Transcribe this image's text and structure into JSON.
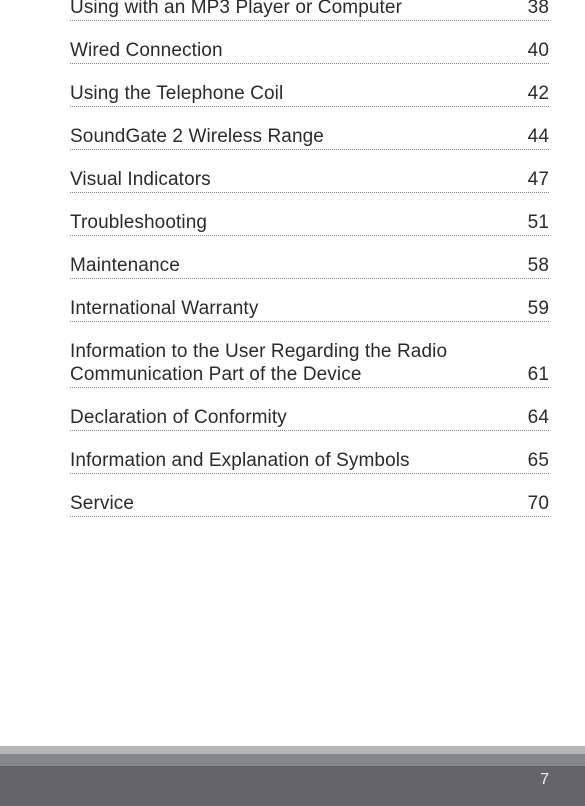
{
  "toc": {
    "entries": [
      {
        "title": "Using with an MP3 Player or Computer",
        "page": "38"
      },
      {
        "title": "Wired Connection",
        "page": "40"
      },
      {
        "title": "Using the Telephone Coil",
        "page": "42"
      },
      {
        "title": "SoundGate 2 Wireless Range",
        "page": "44"
      },
      {
        "title": "Visual Indicators",
        "page": "47"
      },
      {
        "title": "Troubleshooting",
        "page": "51"
      },
      {
        "title": "Maintenance",
        "page": "58"
      },
      {
        "title": "International Warranty",
        "page": "59"
      },
      {
        "title": "Information to the User Regarding the Radio\nCommunication Part of the Device",
        "page": "61"
      },
      {
        "title": "Declaration of Conformity",
        "page": "64"
      },
      {
        "title": "Information and Explanation of Symbols",
        "page": "65"
      },
      {
        "title": "Service",
        "page": "70"
      }
    ]
  },
  "footer": {
    "page_number": "7"
  }
}
